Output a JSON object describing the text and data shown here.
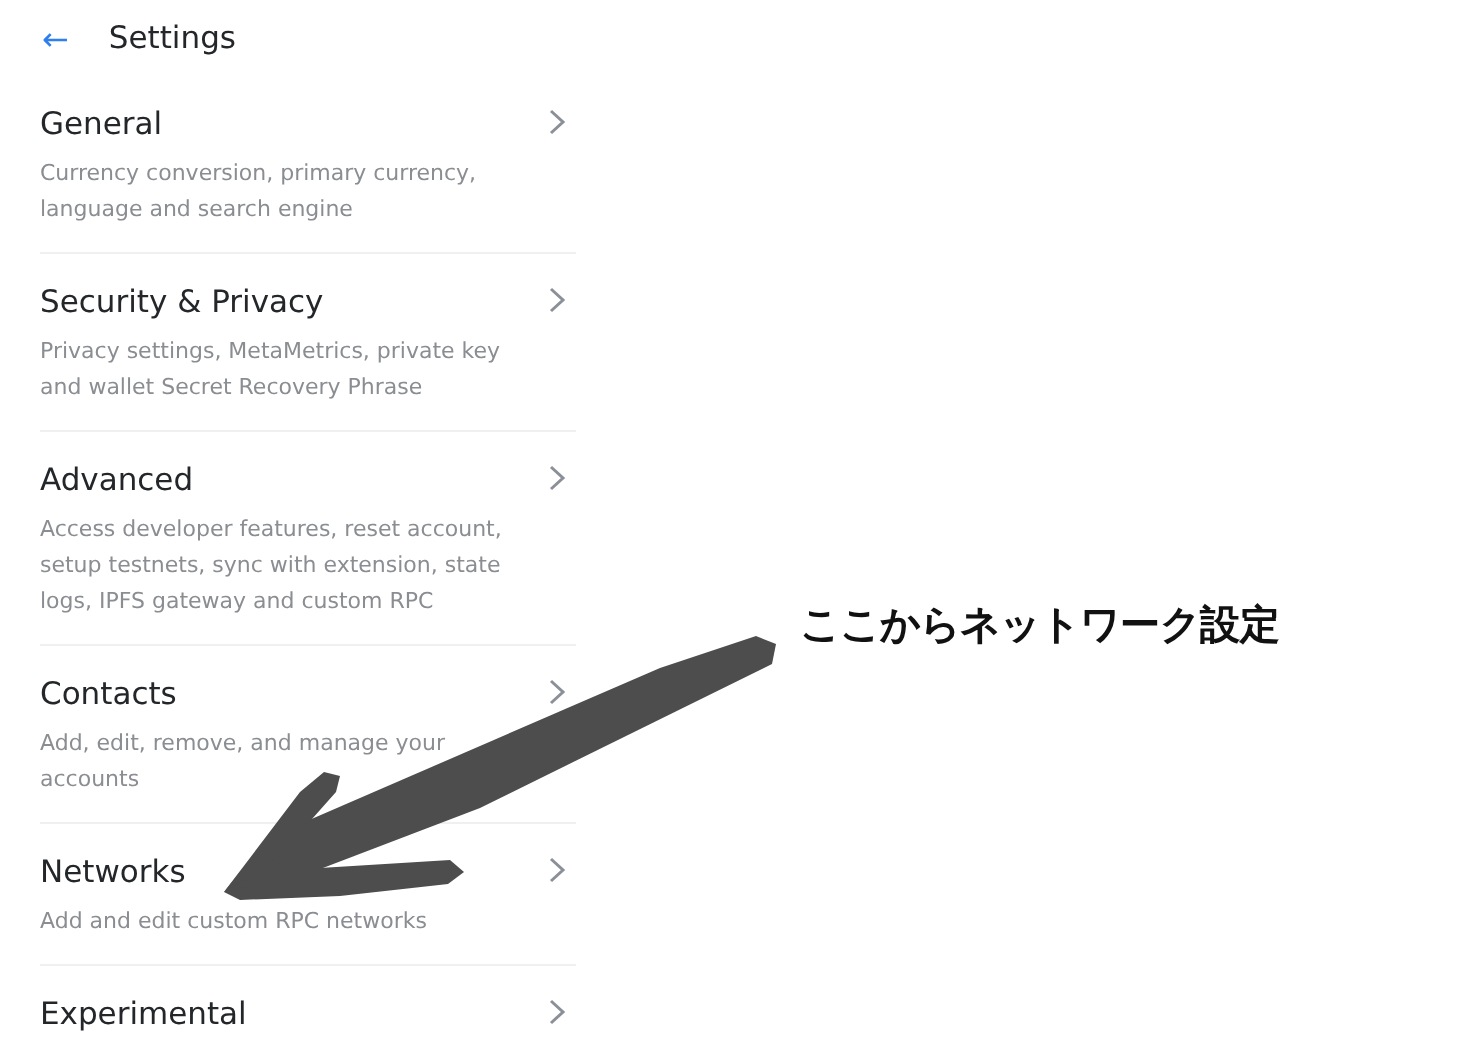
{
  "header": {
    "back_icon": "←",
    "title": "Settings"
  },
  "items": [
    {
      "title": "General",
      "description": "Currency conversion, primary currency, language and search engine"
    },
    {
      "title": "Security & Privacy",
      "description": "Privacy settings, MetaMetrics, private key and wallet Secret Recovery Phrase"
    },
    {
      "title": "Advanced",
      "description": "Access developer features, reset account, setup testnets, sync with extension, state logs, IPFS gateway and custom RPC"
    },
    {
      "title": "Contacts",
      "description": "Add, edit, remove, and manage your accounts"
    },
    {
      "title": "Networks",
      "description": "Add and edit custom RPC networks"
    },
    {
      "title": "Experimental"
    }
  ],
  "annotation": {
    "text": "ここからネットワーク設定"
  }
}
